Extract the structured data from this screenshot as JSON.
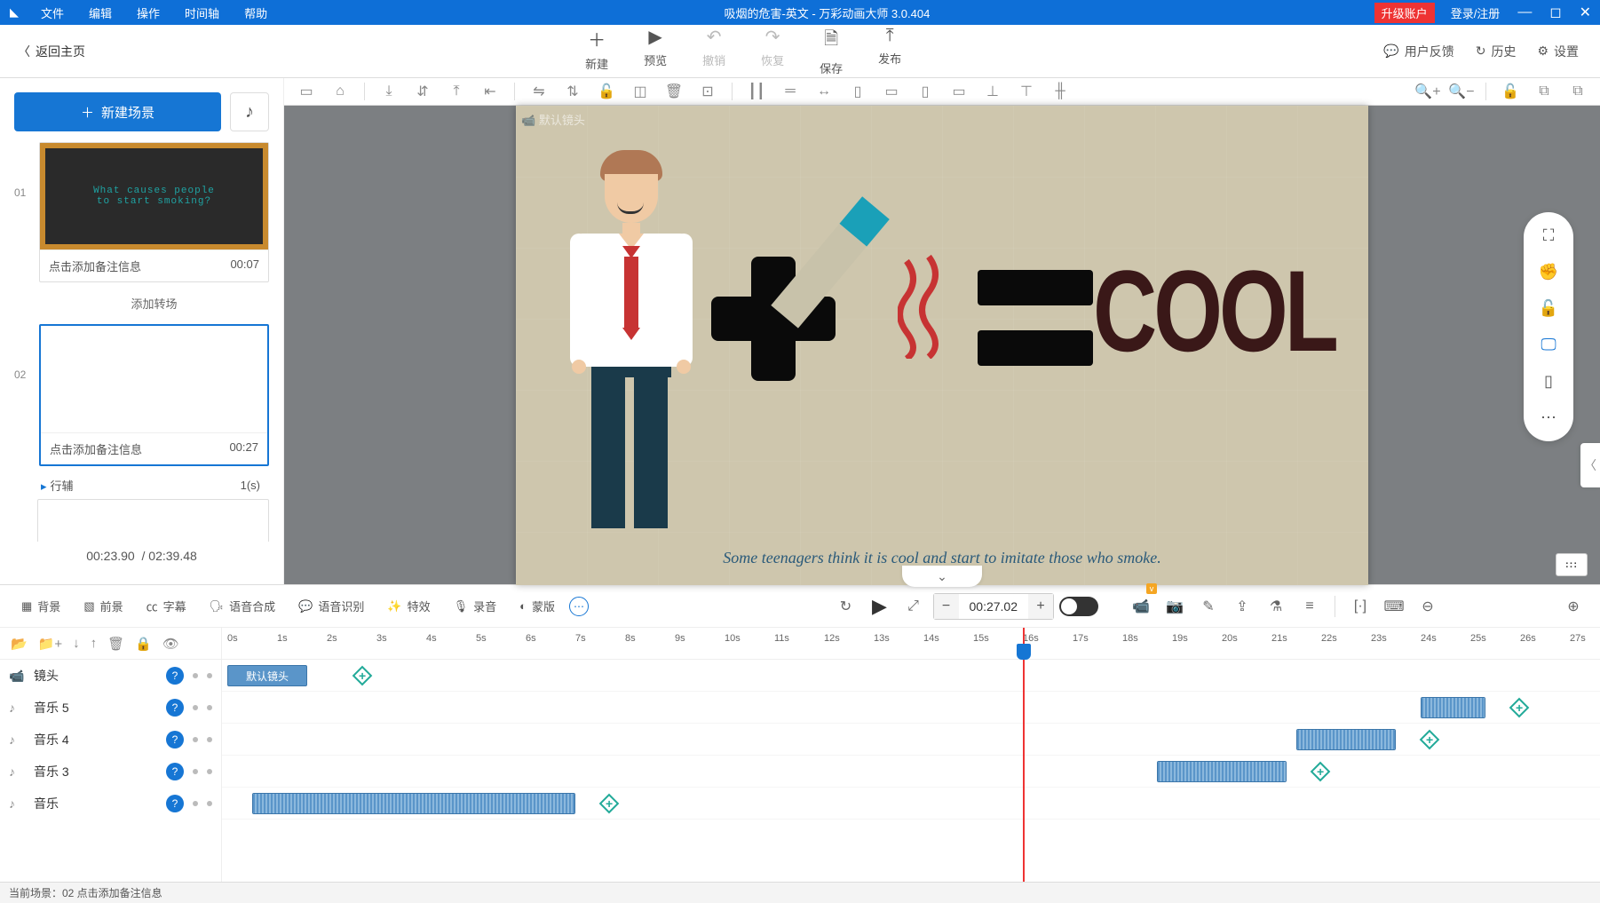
{
  "titlebar": {
    "menus": [
      "文件",
      "编辑",
      "操作",
      "时间轴",
      "帮助"
    ],
    "title": "吸烟的危害-英文 - 万彩动画大师 3.0.404",
    "upgrade": "升级账户",
    "login": "登录/注册"
  },
  "toolbar": {
    "back": "返回主页",
    "buttons": [
      {
        "label": "新建",
        "icon": "＋"
      },
      {
        "label": "预览",
        "icon": "▶"
      },
      {
        "label": "撤销",
        "icon": "↶",
        "disabled": true
      },
      {
        "label": "恢复",
        "icon": "↷",
        "disabled": true
      },
      {
        "label": "保存",
        "icon": "🗎"
      },
      {
        "label": "发布",
        "icon": "⤒"
      }
    ],
    "right": [
      {
        "label": "用户反馈",
        "icon": "💬"
      },
      {
        "label": "历史",
        "icon": "↻"
      },
      {
        "label": "设置",
        "icon": "⚙"
      }
    ]
  },
  "sidebar": {
    "new_scene": "新建场景",
    "scenes": [
      {
        "num": "01",
        "note": "点击添加备注信息",
        "time": "00:07",
        "thumb_text": "What causes people\nto start smoking?"
      },
      {
        "num": "02",
        "note": "点击添加备注信息",
        "time": "00:27",
        "active": true
      }
    ],
    "transition": "添加转场",
    "action": {
      "label": "行辅",
      "val": "1(s)"
    },
    "timecode_cur": "00:23.90",
    "timecode_total": "02:39.48"
  },
  "canvas": {
    "cam_label": "默认镜头",
    "caption": "Some teenagers think it is cool and start to imitate those who smoke.",
    "cool": "COOL"
  },
  "timeline_top": {
    "buttons": [
      {
        "label": "背景",
        "icon": "▦"
      },
      {
        "label": "前景",
        "icon": "▧"
      },
      {
        "label": "字幕",
        "icon": "㏄"
      },
      {
        "label": "语音合成",
        "icon": "🗣"
      },
      {
        "label": "语音识别",
        "icon": "💬"
      },
      {
        "label": "特效",
        "icon": "✨"
      },
      {
        "label": "录音",
        "icon": "🎙"
      },
      {
        "label": "蒙版",
        "icon": "◐"
      }
    ],
    "time": "00:27.02"
  },
  "tracks": [
    {
      "label": "镜头",
      "icon": "📹"
    },
    {
      "label": "音乐 5",
      "icon": "♪"
    },
    {
      "label": "音乐 4",
      "icon": "♪"
    },
    {
      "label": "音乐 3",
      "icon": "♪"
    },
    {
      "label": "音乐",
      "icon": "♪"
    }
  ],
  "default_shot": "默认镜头",
  "playhead_sec": 16,
  "ruler_max": 27,
  "clips": {
    "m5": {
      "start": 24,
      "len": 1.3
    },
    "m4": {
      "start": 21.5,
      "len": 2
    },
    "m3": {
      "start": 18.7,
      "len": 2.6
    },
    "m": {
      "start": 0.5,
      "len": 6.5
    }
  },
  "status": "当前场景：02   点击添加备注信息"
}
